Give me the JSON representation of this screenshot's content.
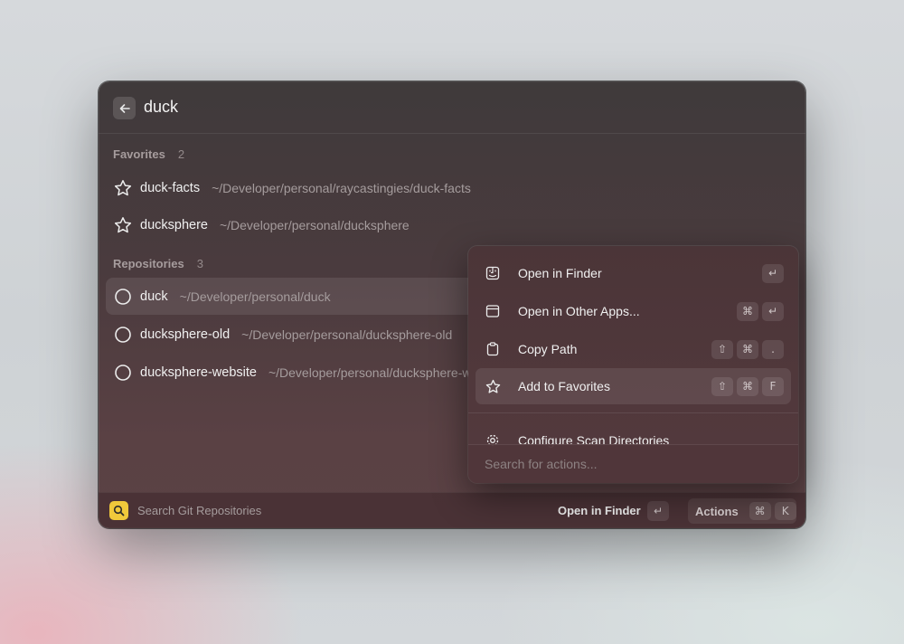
{
  "search": {
    "query": "duck"
  },
  "favorites": {
    "label": "Favorites",
    "count": "2",
    "items": [
      {
        "title": "duck-facts",
        "path": "~/Developer/personal/raycastingies/duck-facts",
        "icon": "star-icon"
      },
      {
        "title": "ducksphere",
        "path": "~/Developer/personal/ducksphere",
        "icon": "star-icon"
      }
    ]
  },
  "repositories": {
    "label": "Repositories",
    "count": "3",
    "items": [
      {
        "title": "duck",
        "path": "~/Developer/personal/duck",
        "icon": "circle-icon"
      },
      {
        "title": "ducksphere-old",
        "path": "~/Developer/personal/ducksphere-old",
        "icon": "circle-icon"
      },
      {
        "title": "ducksphere-website",
        "path": "~/Developer/personal/ducksphere-website",
        "icon": "circle-icon"
      }
    ]
  },
  "actions_menu": {
    "items": [
      {
        "label": "Open in Finder",
        "icon": "finder-icon",
        "keys": [
          "↵"
        ]
      },
      {
        "label": "Open in Other Apps...",
        "icon": "window-icon",
        "keys": [
          "⌘",
          "↵"
        ]
      },
      {
        "label": "Copy Path",
        "icon": "clipboard-icon",
        "keys": [
          "⇧",
          "⌘",
          "."
        ]
      },
      {
        "label": "Add to Favorites",
        "icon": "star-icon",
        "keys": [
          "⇧",
          "⌘",
          "F"
        ]
      },
      {
        "label": "Configure Scan Directories",
        "icon": "gear-icon",
        "keys": []
      }
    ],
    "search_placeholder": "Search for actions..."
  },
  "footer": {
    "label": "Search Git Repositories",
    "primary_action": "Open in Finder",
    "primary_key": "↵",
    "actions_label": "Actions",
    "actions_keys": [
      "⌘",
      "K"
    ]
  },
  "colors": {
    "accent": "#f0c93b"
  }
}
